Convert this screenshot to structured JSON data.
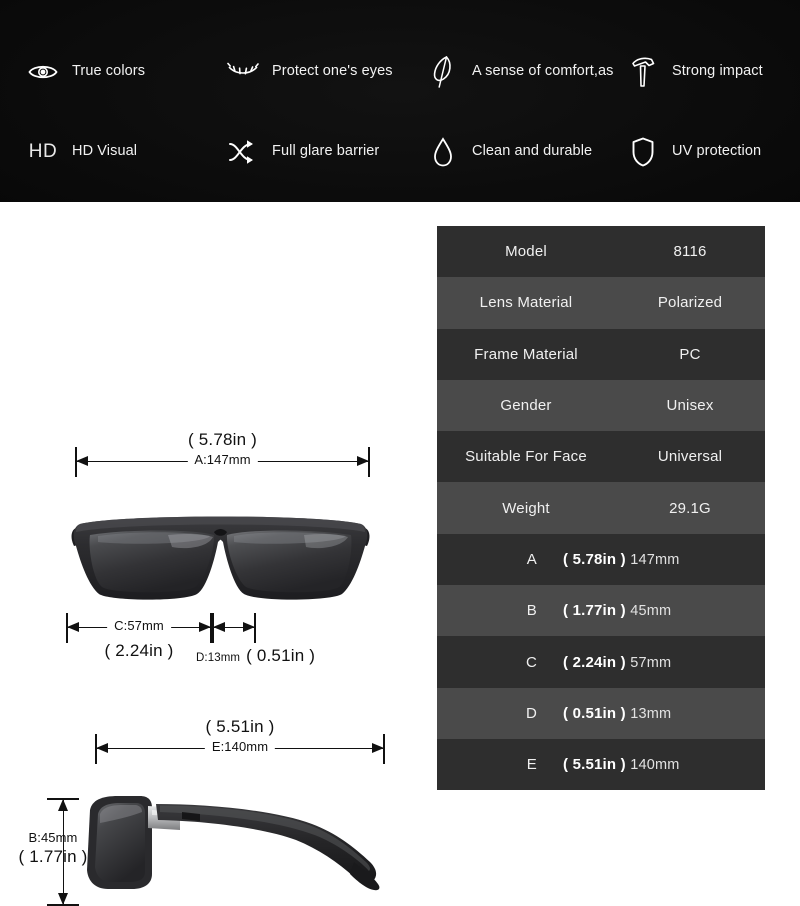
{
  "banner": {
    "features": [
      {
        "icon": "eye-icon",
        "label": "True colors"
      },
      {
        "icon": "eyelash-icon",
        "label": "Protect one's eyes"
      },
      {
        "icon": "feather-icon",
        "label": "A sense of comfort,as"
      },
      {
        "icon": "hammer-icon",
        "label": "Strong impact"
      },
      {
        "icon": "hd-text-icon",
        "label": "HD Visual",
        "glyph": "HD"
      },
      {
        "icon": "shuffle-arrows-icon",
        "label": "Full glare barrier"
      },
      {
        "icon": "water-drop-icon",
        "label": "Clean and durable"
      },
      {
        "icon": "shield-icon",
        "label": "UV protection"
      }
    ]
  },
  "diagram": {
    "front_view_alt": "Front view of black square polarized sunglasses",
    "side_view_alt": "Side profile view of black sunglasses temple arm",
    "dim_a": {
      "inches": "( 5.78in )",
      "mm": "A:147mm"
    },
    "dim_b": {
      "inches": "( 1.77in )",
      "mm": "B:45mm"
    },
    "dim_c": {
      "inches": "( 2.24in )",
      "mm": "C:57mm"
    },
    "dim_d": {
      "inches": "( 0.51in )",
      "mm": "D:13mm"
    },
    "dim_e": {
      "inches": "( 5.51in )",
      "mm": "E:140mm"
    }
  },
  "spec_table": {
    "rows": [
      {
        "key": "Model",
        "value": "8116",
        "type": "text"
      },
      {
        "key": "Lens Material",
        "value": "Polarized",
        "type": "text"
      },
      {
        "key": "Frame Material",
        "value": "PC",
        "type": "text"
      },
      {
        "key": "Gender",
        "value": "Unisex",
        "type": "text"
      },
      {
        "key": "Suitable For Face",
        "value": "Universal",
        "type": "text"
      },
      {
        "key": "Weight",
        "value": "29.1G",
        "type": "text"
      },
      {
        "key": "A",
        "inches": "( 5.78in )",
        "mm": "147mm",
        "type": "dimension"
      },
      {
        "key": "B",
        "inches": "( 1.77in )",
        "mm": "45mm",
        "type": "dimension"
      },
      {
        "key": "C",
        "inches": "( 2.24in )",
        "mm": "57mm",
        "type": "dimension"
      },
      {
        "key": "D",
        "inches": "( 0.51in )",
        "mm": "13mm",
        "type": "dimension"
      },
      {
        "key": "E",
        "inches": "( 5.51in )",
        "mm": "140mm",
        "type": "dimension"
      }
    ]
  },
  "colors": {
    "banner_background": "#060606",
    "row_dark": "#2e2e2e",
    "row_light": "#4a4a4a",
    "text_light": "#f0f0f0",
    "dimension_line": "#111111",
    "frame_black": "#2a2a2c",
    "lens_gray": "#3c3c3e"
  }
}
